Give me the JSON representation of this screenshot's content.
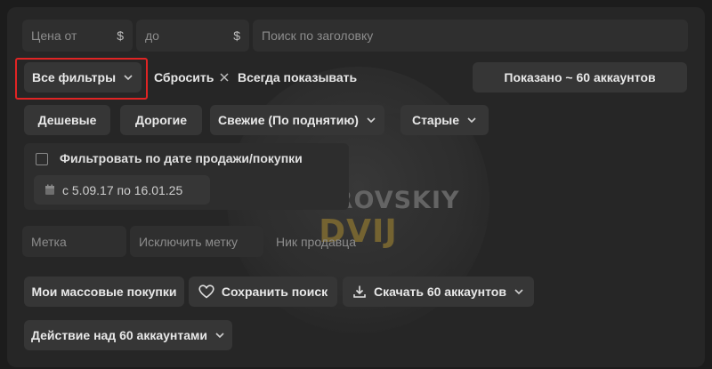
{
  "price": {
    "from_placeholder": "Цена от",
    "to_placeholder": "до",
    "currency": "$",
    "search_placeholder": "Поиск по заголовку"
  },
  "toolbar": {
    "all_filters": "Все фильтры",
    "reset": "Сбросить",
    "always_show": "Всегда показывать",
    "shown": "Показано ~ 60 аккаунтов"
  },
  "sort": {
    "cheap": "Дешевые",
    "expensive": "Дорогие",
    "fresh": "Свежие (По поднятию)",
    "old": "Старые"
  },
  "date_filter": {
    "label": "Фильтровать по дате продажи/покупки",
    "range": "с 5.09.17 по 16.01.25",
    "checked": false
  },
  "tags": {
    "tag_placeholder": "Метка",
    "exclude_placeholder": "Исключить метку",
    "seller_placeholder": "Ник продавца"
  },
  "actions": {
    "my_purchases": "Мои массовые покупки",
    "save_search": "Сохранить поиск",
    "download": "Скачать 60 аккаунтов",
    "bulk_action": "Действие над 60 аккаунтами"
  },
  "watermark": {
    "line1": "DNEPROVSKIY",
    "line2": "DVIJ"
  },
  "colors": {
    "background": "#1c1c1c",
    "panel": "#262626",
    "button": "#363636",
    "highlight": "#e02424"
  }
}
